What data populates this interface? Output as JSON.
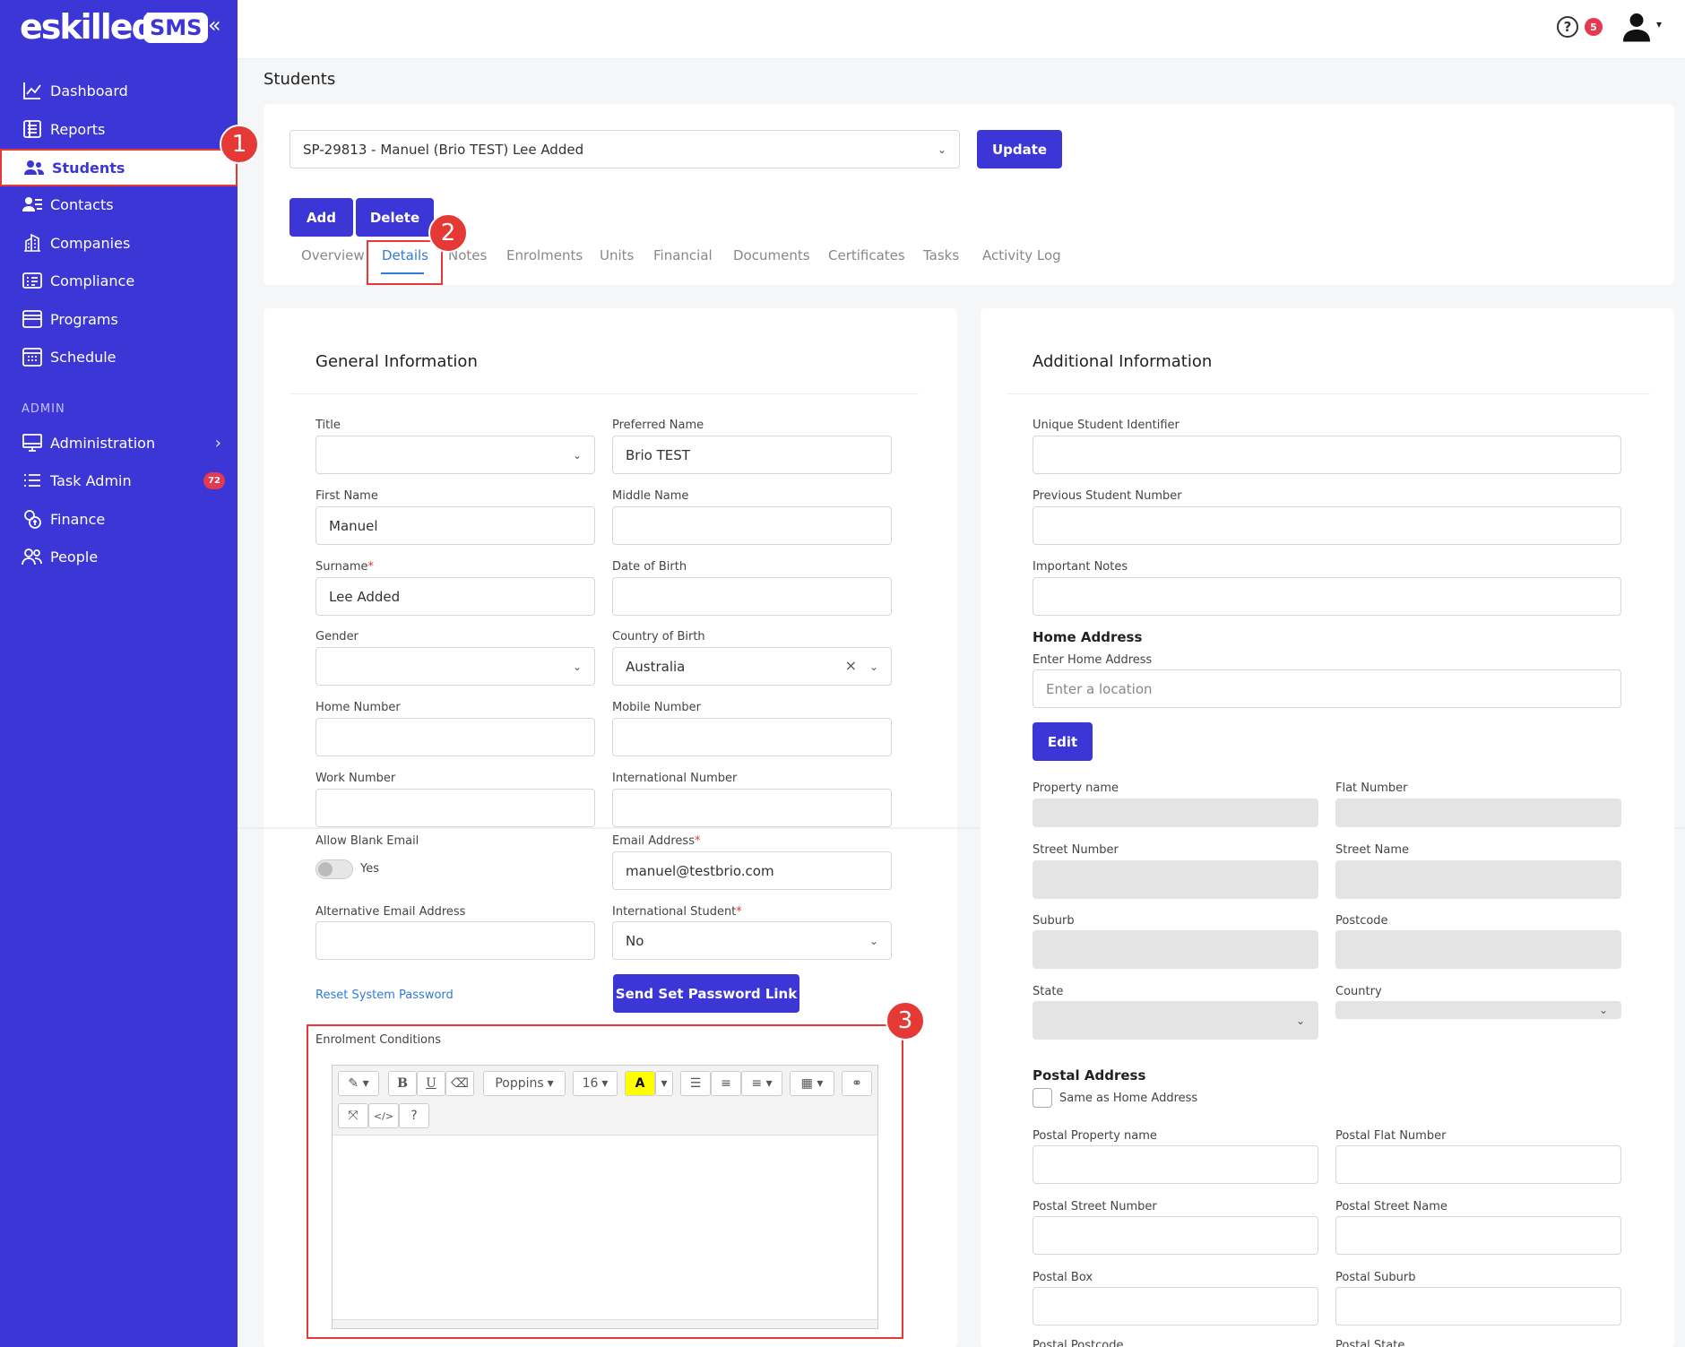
{
  "app": {
    "logo_text": "eskilled",
    "logo_badge": "SMS",
    "collapse_icon": "«",
    "brand_color": "#3c36d6"
  },
  "sidebar": {
    "items": [
      {
        "label": "Dashboard",
        "icon": "chart-line-icon"
      },
      {
        "label": "Reports",
        "icon": "report-icon"
      },
      {
        "label": "Students",
        "icon": "users-icon",
        "active": true
      },
      {
        "label": "Contacts",
        "icon": "contact-card-icon"
      },
      {
        "label": "Companies",
        "icon": "building-icon"
      },
      {
        "label": "Compliance",
        "icon": "checklist-icon"
      },
      {
        "label": "Programs",
        "icon": "window-icon"
      },
      {
        "label": "Schedule",
        "icon": "calendar-icon"
      }
    ],
    "admin_heading": "ADMIN",
    "admin_items": [
      {
        "label": "Administration",
        "icon": "monitor-icon",
        "has_submenu": true
      },
      {
        "label": "Task Admin",
        "icon": "list-icon",
        "badge": "72"
      },
      {
        "label": "Finance",
        "icon": "coins-icon"
      },
      {
        "label": "People",
        "icon": "people-icon"
      }
    ]
  },
  "topbar": {
    "help_icon": "?",
    "notification_count": "5",
    "user_caret": "▾"
  },
  "page": {
    "title": "Students"
  },
  "record": {
    "selected": "SP-29813 - Manuel (Brio TEST) Lee Added",
    "update_label": "Update",
    "add_label": "Add",
    "delete_label": "Delete"
  },
  "tabs": [
    "Overview",
    "Details",
    "Notes",
    "Enrolments",
    "Units",
    "Financial",
    "Documents",
    "Certificates",
    "Tasks",
    "Activity Log"
  ],
  "active_tab": "Details",
  "markers": [
    "1",
    "2",
    "3"
  ],
  "general": {
    "heading": "General Information",
    "title_label": "Title",
    "title_value": "",
    "preferred_label": "Preferred Name",
    "preferred_value": "Brio TEST",
    "first_label": "First Name",
    "first_value": "Manuel",
    "middle_label": "Middle Name",
    "middle_value": "",
    "surname_label": "Surname",
    "surname_value": "Lee Added",
    "dob_label": "Date of Birth",
    "dob_value": "",
    "gender_label": "Gender",
    "gender_value": "",
    "cob_label": "Country of Birth",
    "cob_value": "Australia",
    "clear_icon": "×",
    "home_label": "Home Number",
    "mobile_label": "Mobile Number",
    "work_label": "Work Number",
    "intl_label": "International Number",
    "blank_email_label": "Allow Blank Email",
    "blank_email_toggle": "Yes",
    "email_label": "Email Address",
    "email_value": "manuel@testbrio.com",
    "alt_email_label": "Alternative Email Address",
    "intl_student_label": "International Student",
    "intl_student_value": "No",
    "reset_link": "Reset System Password",
    "send_link_button": "Send Set Password Link",
    "enrol_conditions_label": "Enrolment Conditions",
    "required_mark": "*"
  },
  "editor": {
    "font": "Poppins",
    "size": "16",
    "highlight": "A",
    "code": "</>",
    "help": "?"
  },
  "additional": {
    "heading": "Additional Information",
    "usi_label": "Unique Student Identifier",
    "prev_label": "Previous Student Number",
    "notes_label": "Important Notes",
    "home_heading": "Home Address",
    "enter_home_label": "Enter Home Address",
    "location_placeholder": "Enter a location",
    "edit_label": "Edit",
    "property_label": "Property name",
    "flat_label": "Flat Number",
    "street_no_label": "Street Number",
    "street_name_label": "Street Name",
    "suburb_label": "Suburb",
    "postcode_label": "Postcode",
    "state_label": "State",
    "country_label": "Country",
    "postal_heading": "Postal Address",
    "same_as_home": "Same as Home Address",
    "postal_property_label": "Postal Property name",
    "postal_flat_label": "Postal Flat Number",
    "postal_street_no_label": "Postal Street Number",
    "postal_street_name_label": "Postal Street Name",
    "postal_box_label": "Postal Box",
    "postal_suburb_label": "Postal Suburb",
    "postal_postcode_label": "Postal Postcode",
    "postal_state_label": "Postal State"
  }
}
